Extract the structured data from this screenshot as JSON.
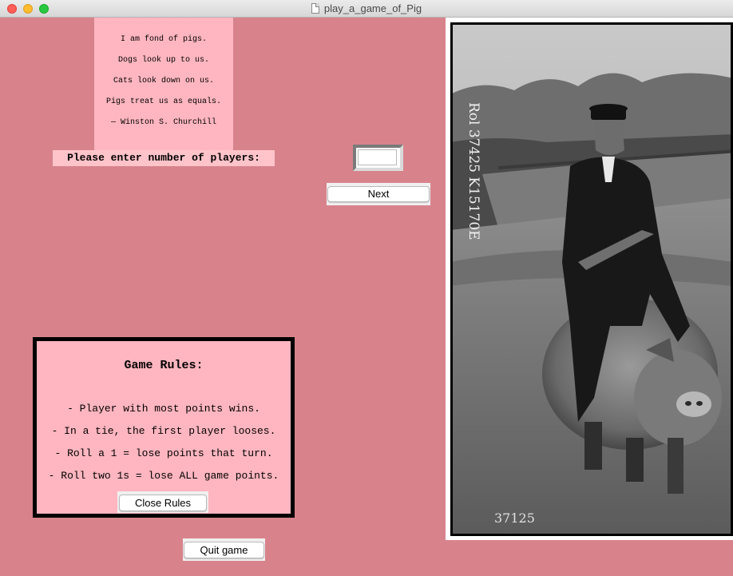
{
  "window": {
    "title": "play_a_game_of_Pig"
  },
  "quote": {
    "lines": [
      "I am fond of pigs.",
      "Dogs look up to us.",
      "Cats look down on us.",
      "Pigs treat us as equals.",
      "— Winston S. Churchill"
    ]
  },
  "prompt": {
    "label": "Please enter number of players:"
  },
  "players_input": {
    "value": ""
  },
  "buttons": {
    "next": "Next",
    "close_rules": "Close Rules",
    "quit": "Quit game"
  },
  "rules": {
    "title": "Game Rules:",
    "items": [
      "- Player with most points wins.",
      "- In a tie, the first player looses.",
      "- Roll a 1 = lose points that turn.",
      "- Roll two 1s = lose ALL game points."
    ]
  },
  "photo": {
    "caption_vertical": "Rol 37425 K15170E",
    "caption_bottom": "37125"
  },
  "colors": {
    "background": "#d8838c",
    "panel": "#ffb6c0",
    "prompt_bg": "#ffc4ca"
  }
}
